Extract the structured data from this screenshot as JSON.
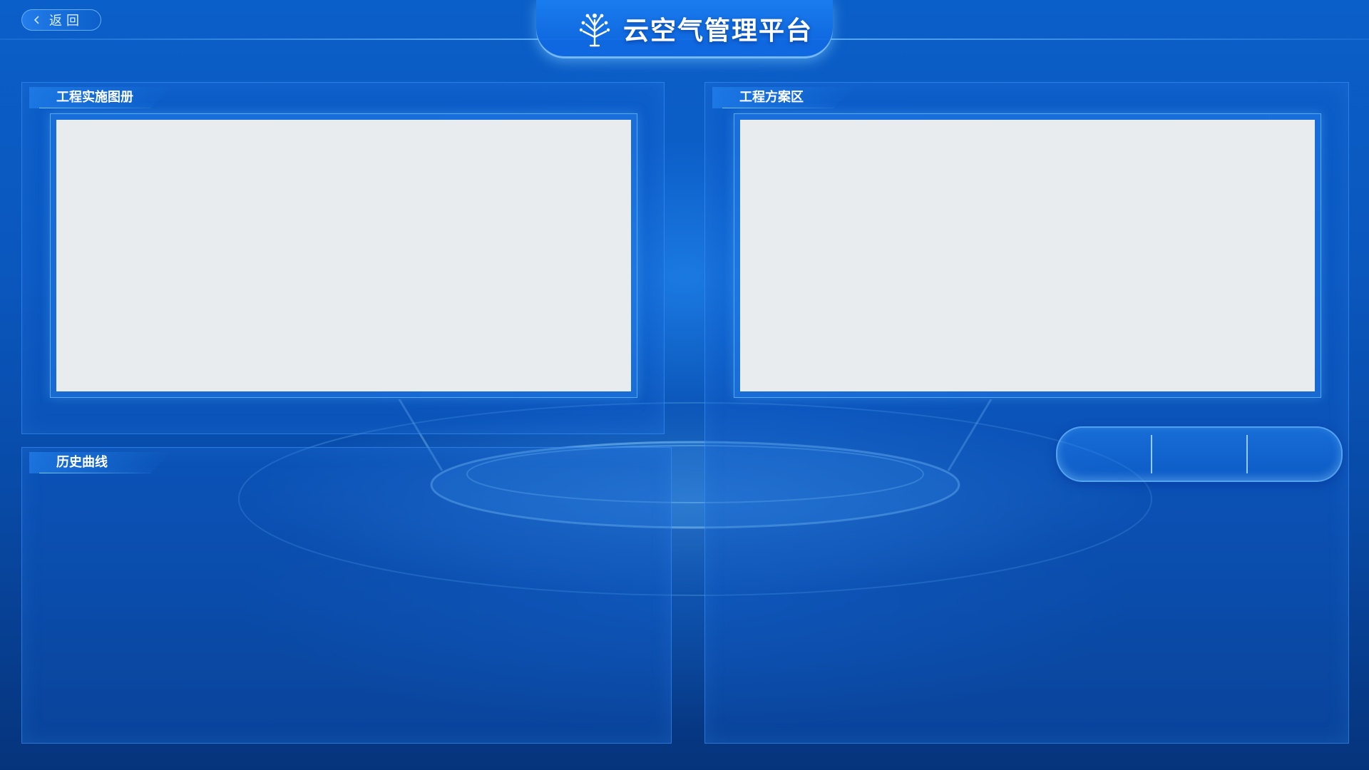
{
  "header": {
    "title": "云空气管理平台",
    "logo_icon": "tree-icon",
    "back_label": "返回",
    "back_icon": "chevron-left-icon"
  },
  "panels": {
    "gallery": {
      "title": "工程实施图册"
    },
    "history": {
      "title": "历史曲线"
    },
    "plans": {
      "title": "工程方案区"
    }
  },
  "tabs": {
    "items": [
      {
        "label": ""
      },
      {
        "label": ""
      },
      {
        "label": ""
      }
    ]
  },
  "colors": {
    "background_top": "#0b5fc8",
    "background_bottom": "#06347c",
    "panel_border": "#3c96ff",
    "placeholder": "#e9ecef",
    "title_text": "#ffffff"
  }
}
